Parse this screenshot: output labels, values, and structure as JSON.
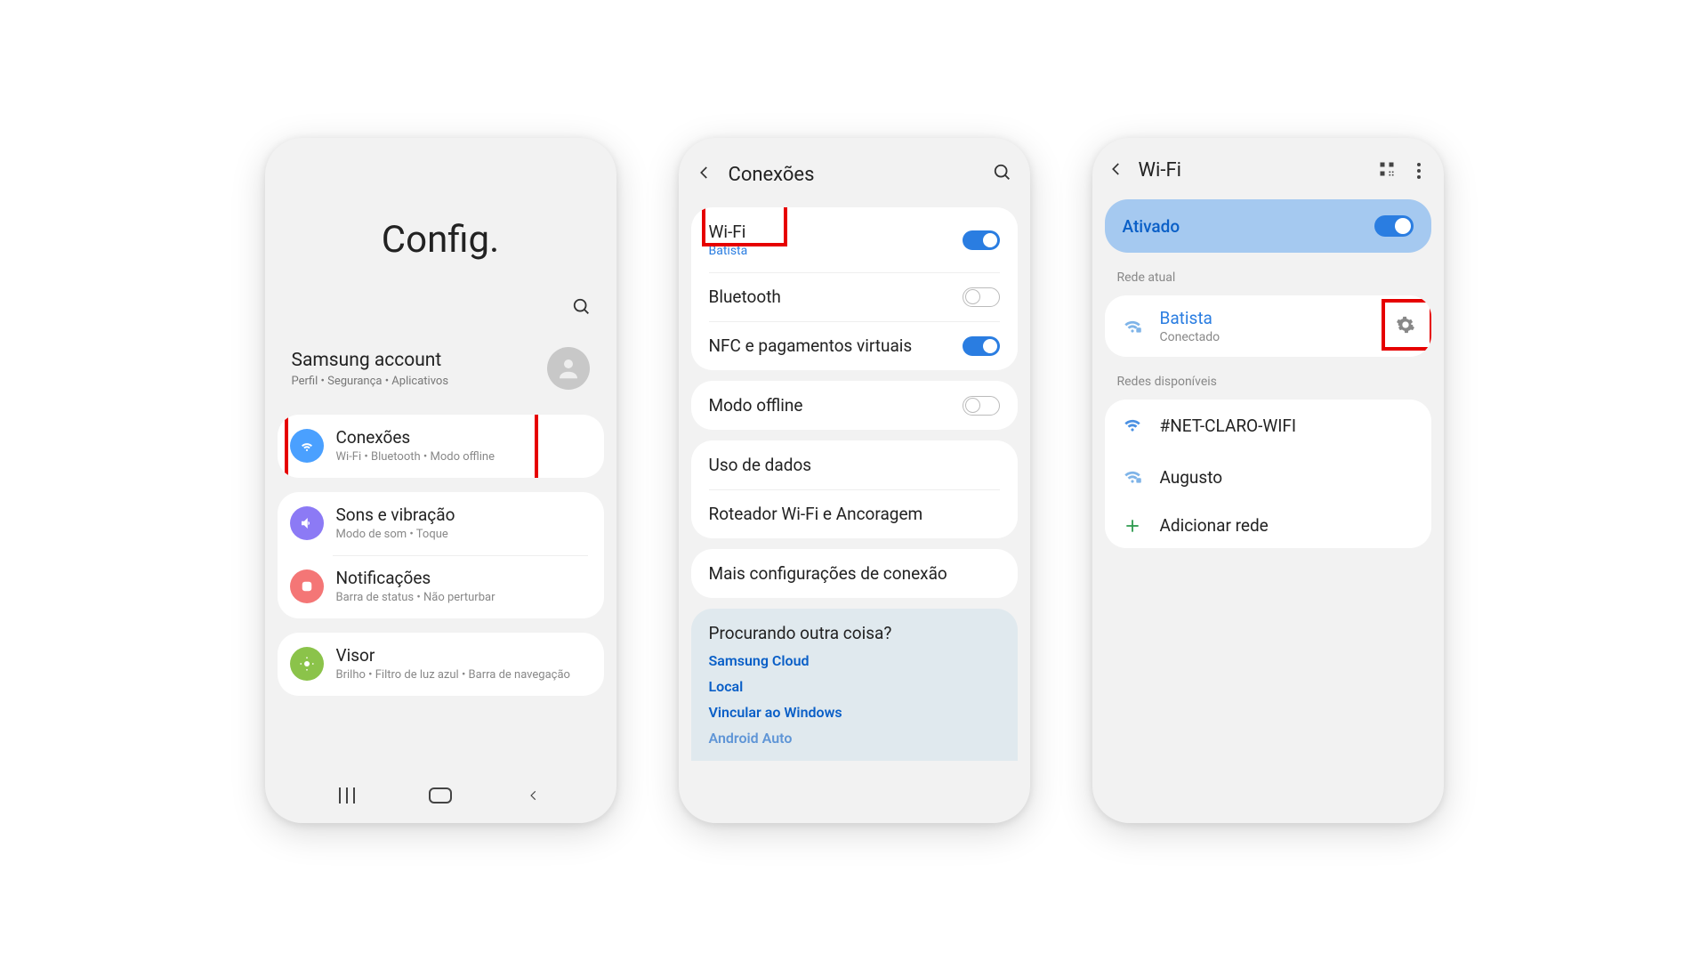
{
  "phone1": {
    "title": "Config.",
    "account": {
      "title": "Samsung account",
      "sub": "Perfil  •  Segurança  •  Aplicativos"
    },
    "items": {
      "connections": {
        "title": "Conexões",
        "sub": "Wi-Fi  •  Bluetooth  •  Modo offline"
      },
      "sound": {
        "title": "Sons e vibração",
        "sub": "Modo de som  •  Toque"
      },
      "notif": {
        "title": "Notificações",
        "sub": "Barra de status  •  Não perturbar"
      },
      "display": {
        "title": "Visor",
        "sub": "Brilho  •  Filtro de luz azul  •  Barra de navegação"
      }
    }
  },
  "phone2": {
    "header": "Conexões",
    "rows": {
      "wifi": {
        "title": "Wi-Fi",
        "sub": "Batista"
      },
      "bt": {
        "title": "Bluetooth"
      },
      "nfc": {
        "title": "NFC e pagamentos virtuais"
      },
      "offline": {
        "title": "Modo offline"
      },
      "data": {
        "title": "Uso de dados"
      },
      "router": {
        "title": "Roteador Wi-Fi e Ancoragem"
      },
      "more": {
        "title": "Mais configurações de conexão"
      }
    },
    "help": {
      "title": "Procurando outra coisa?",
      "links": [
        "Samsung Cloud",
        "Local",
        "Vincular ao Windows",
        "Android Auto"
      ]
    }
  },
  "phone3": {
    "header": "Wi-Fi",
    "activated": "Ativado",
    "current_label": "Rede atual",
    "current": {
      "name": "Batista",
      "status": "Conectado"
    },
    "available_label": "Redes disponíveis",
    "networks": [
      "#NET-CLARO-WIFI",
      "Augusto"
    ],
    "add": "Adicionar rede"
  }
}
